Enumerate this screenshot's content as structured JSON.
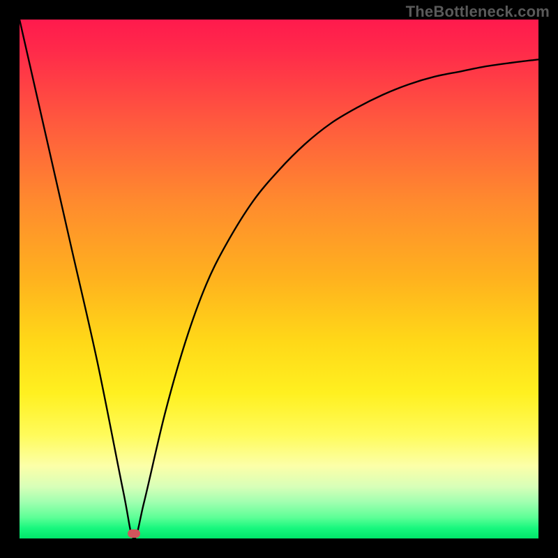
{
  "watermark": "TheBottleneck.com",
  "colors": {
    "frame": "#000000",
    "curve": "#000000",
    "marker": "#d1555c",
    "gradient_top": "#ff1a4d",
    "gradient_bottom": "#00e66a"
  },
  "chart_data": {
    "type": "line",
    "title": "",
    "xlabel": "",
    "ylabel": "",
    "xlim": [
      0,
      100
    ],
    "ylim": [
      0,
      100
    ],
    "annotations": [
      {
        "type": "marker",
        "x": 22,
        "y": 1,
        "shape": "pill",
        "color": "#d1555c"
      }
    ],
    "series": [
      {
        "name": "bottleneck-curve",
        "x": [
          0,
          5,
          10,
          15,
          20,
          22,
          24,
          28,
          32,
          36,
          40,
          45,
          50,
          55,
          60,
          65,
          70,
          75,
          80,
          85,
          90,
          95,
          100
        ],
        "values": [
          100,
          78,
          56,
          34,
          9,
          0,
          7,
          24,
          38,
          49,
          57,
          65,
          71,
          76,
          80,
          83,
          85.5,
          87.5,
          89,
          90,
          91,
          91.7,
          92.3
        ]
      }
    ],
    "background": {
      "type": "vertical-gradient",
      "meaning": "color scale from red (high/bad) at top to green (low/good) at bottom"
    }
  }
}
